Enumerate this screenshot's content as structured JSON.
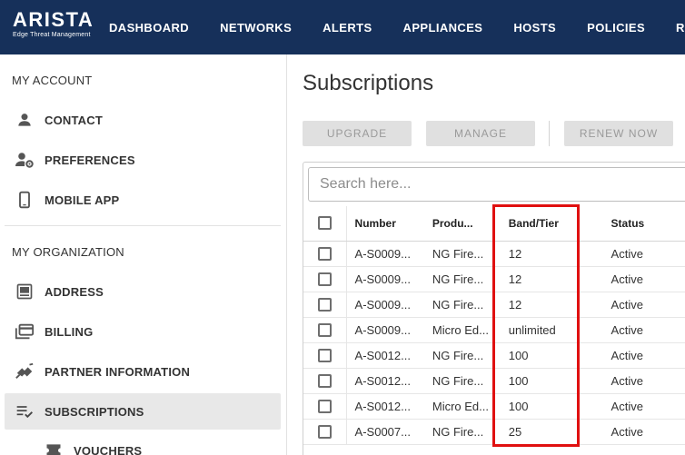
{
  "header": {
    "logo": {
      "brand": "ARISTA",
      "tagline": "Edge Threat Management"
    },
    "nav": [
      "DASHBOARD",
      "NETWORKS",
      "ALERTS",
      "APPLIANCES",
      "HOSTS",
      "POLICIES",
      "REP"
    ]
  },
  "sidebar": {
    "my_account": {
      "title": "MY ACCOUNT",
      "items": [
        {
          "label": "CONTACT",
          "icon": "person-icon"
        },
        {
          "label": "PREFERENCES",
          "icon": "user-settings-icon"
        },
        {
          "label": "MOBILE APP",
          "icon": "phone-icon"
        }
      ]
    },
    "my_organization": {
      "title": "MY ORGANIZATION",
      "items": [
        {
          "label": "ADDRESS",
          "icon": "address-card-icon"
        },
        {
          "label": "BILLING",
          "icon": "billing-icon"
        },
        {
          "label": "PARTNER INFORMATION",
          "icon": "handshake-icon"
        },
        {
          "label": "SUBSCRIPTIONS",
          "icon": "subscriptions-list-icon",
          "active": true
        },
        {
          "label": "VOUCHERS",
          "icon": "voucher-icon"
        }
      ]
    }
  },
  "main": {
    "title": "Subscriptions",
    "buttons": {
      "upgrade": "UPGRADE",
      "manage": "MANAGE",
      "renew": "RENEW NOW"
    },
    "search": {
      "placeholder": "Search here..."
    },
    "table": {
      "headers": {
        "number": "Number",
        "product": "Produ...",
        "band": "Band/Tier",
        "status": "Status"
      },
      "rows": [
        {
          "number": "A-S0009...",
          "product": "NG Fire...",
          "band": "12",
          "status": "Active"
        },
        {
          "number": "A-S0009...",
          "product": "NG Fire...",
          "band": "12",
          "status": "Active"
        },
        {
          "number": "A-S0009...",
          "product": "NG Fire...",
          "band": "12",
          "status": "Active"
        },
        {
          "number": "A-S0009...",
          "product": "Micro Ed...",
          "band": "unlimited",
          "status": "Active"
        },
        {
          "number": "A-S0012...",
          "product": "NG Fire...",
          "band": "100",
          "status": "Active"
        },
        {
          "number": "A-S0012...",
          "product": "NG Fire...",
          "band": "100",
          "status": "Active"
        },
        {
          "number": "A-S0012...",
          "product": "Micro Ed...",
          "band": "100",
          "status": "Active"
        },
        {
          "number": "A-S0007...",
          "product": "NG Fire...",
          "band": "25",
          "status": "Active"
        }
      ]
    }
  },
  "colors": {
    "header_bg": "#16305a",
    "highlight": "#e01010",
    "active_item_bg": "#e8e8e8"
  }
}
